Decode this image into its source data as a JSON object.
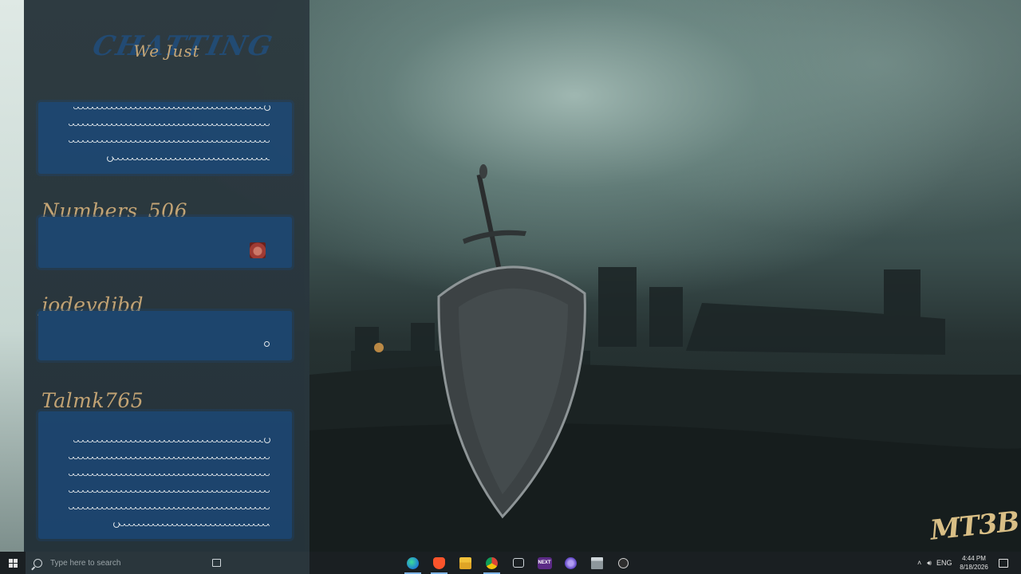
{
  "chat": {
    "title_bg": "CHATTING",
    "title": "We Just",
    "messages": [
      {
        "author": ""
      },
      {
        "author": "Numbers_506"
      },
      {
        "author": "jodevdjbd"
      },
      {
        "author": "Talmk765"
      }
    ]
  },
  "logo": {
    "text": "MT3B"
  },
  "taskbar": {
    "search_placeholder": "Type here to search",
    "apps": [
      {
        "name": "edge-icon",
        "label": ""
      },
      {
        "name": "brave-icon",
        "label": ""
      },
      {
        "name": "file-explorer-icon",
        "label": ""
      },
      {
        "name": "chrome-icon",
        "label": ""
      },
      {
        "name": "xbox-icon",
        "label": ""
      },
      {
        "name": "next-app-icon",
        "label": "NEXT"
      },
      {
        "name": "game-launcher-icon",
        "label": ""
      },
      {
        "name": "window-app-icon",
        "label": ""
      },
      {
        "name": "obs-icon",
        "label": ""
      }
    ],
    "tray": {
      "language": "ENG",
      "time": "4:44 PM",
      "date": "8/18/2026"
    }
  },
  "colors": {
    "accent_gold": "#c9a877",
    "message_blue": "#1d4670",
    "taskbar": "#1a1f22"
  }
}
